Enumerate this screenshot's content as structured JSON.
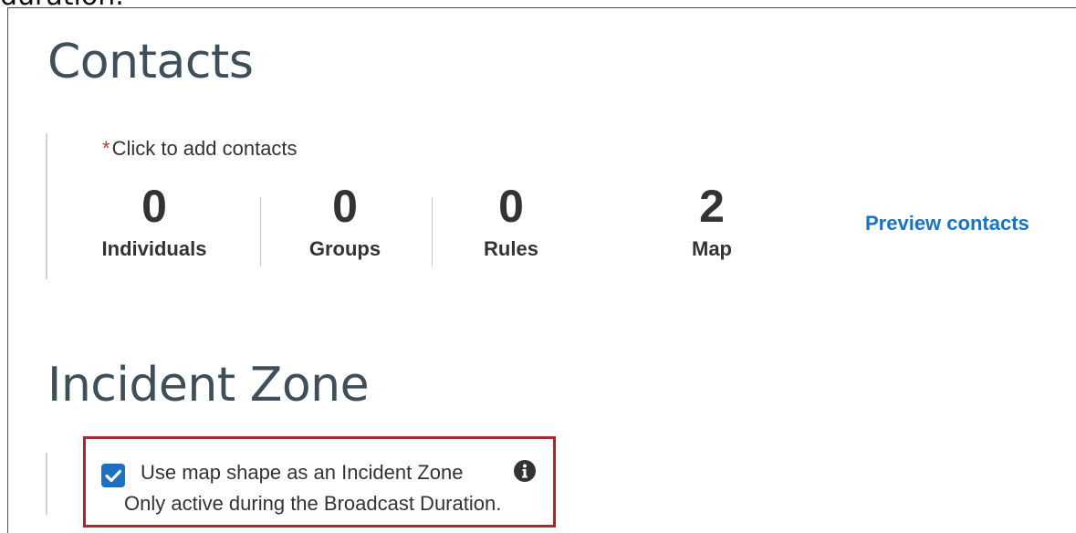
{
  "top_partial_text": "duration.",
  "contacts": {
    "title": "Contacts",
    "required_marker": "*",
    "add_prompt": "Click to add contacts",
    "stats": [
      {
        "value": "0",
        "label": "Individuals"
      },
      {
        "value": "0",
        "label": "Groups"
      },
      {
        "value": "0",
        "label": "Rules"
      },
      {
        "value": "2",
        "label": "Map"
      }
    ],
    "preview_label": "Preview contacts"
  },
  "incident_zone": {
    "title": "Incident Zone",
    "checkbox_checked": true,
    "checkbox_label": "Use map shape as an Incident Zone",
    "note": "Only active during the Broadcast Duration."
  },
  "colors": {
    "accent": "#1f6fbf",
    "link": "#1a73c2",
    "required": "#c0392b",
    "highlight_border": "#a12a35",
    "heading": "#3f4f5a"
  },
  "icons": {
    "checkbox": "check-icon",
    "info": "info-icon"
  }
}
